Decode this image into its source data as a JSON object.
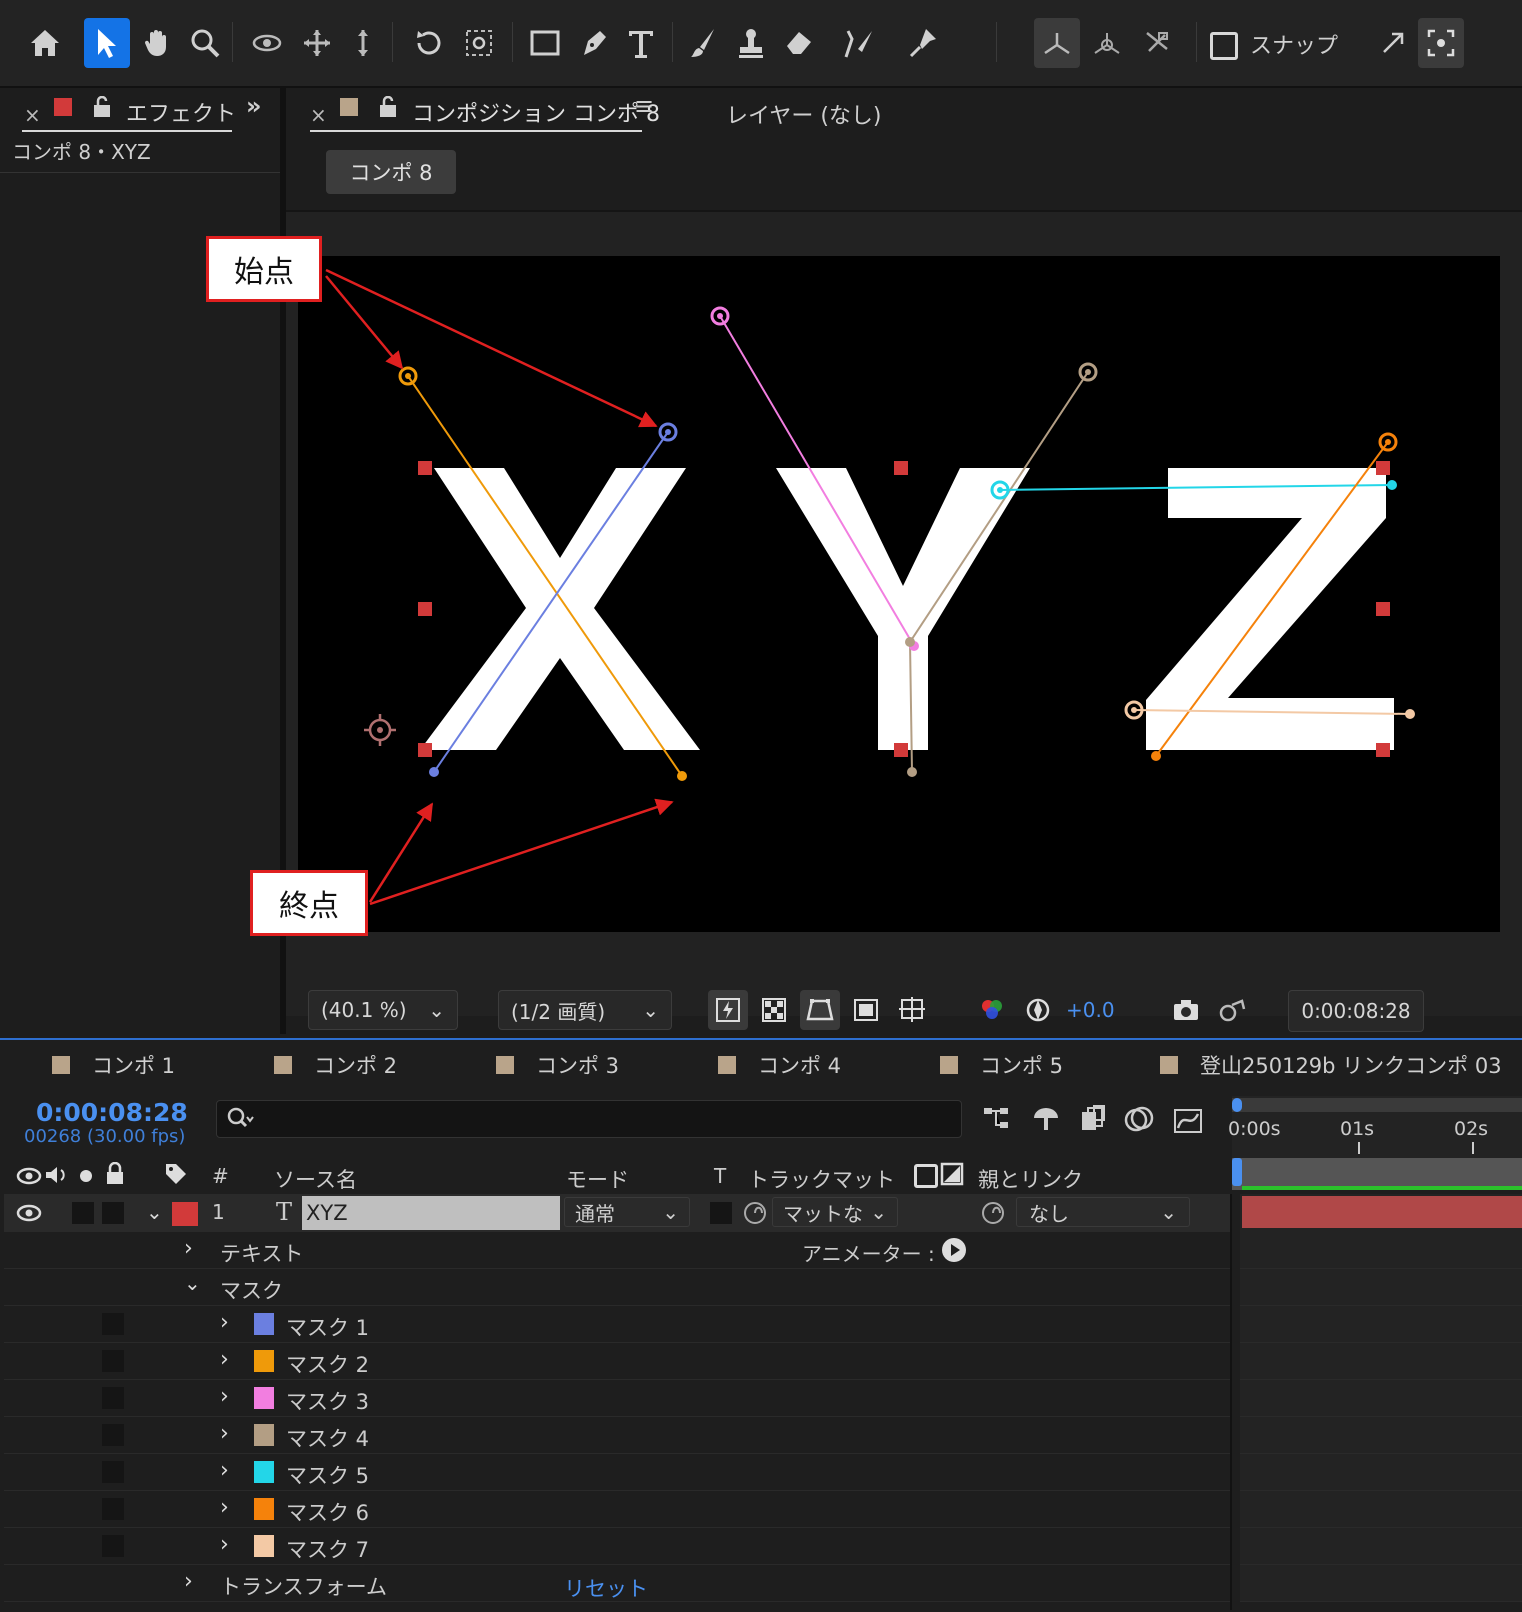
{
  "toolbar": {
    "snap_label": "スナップ",
    "icons": [
      "home-icon",
      "selection-tool-icon",
      "hand-tool-icon",
      "zoom-tool-icon",
      "orbit-camera-icon",
      "pan-camera-icon",
      "dolly-camera-icon",
      "rotation-tool-icon",
      "anchor-point-tool-icon",
      "rectangle-tool-icon",
      "pen-tool-icon",
      "type-tool-icon",
      "brush-tool-icon",
      "clone-stamp-icon",
      "eraser-tool-icon",
      "roto-brush-icon",
      "puppet-pin-icon",
      "local-axis-icon",
      "world-axis-icon",
      "view-axis-icon",
      "snap-checkbox",
      "expand-icon",
      "workspace-icon"
    ]
  },
  "effects_panel": {
    "tab_label": "エフェクトコ",
    "chip_color": "#d23a3a",
    "subtitle": "コンポ 8・XYZ"
  },
  "comp_panel": {
    "tab_label": "コンポジション コンポ 8",
    "chip_color": "#b9a48a",
    "layer_label": "レイヤー (なし)",
    "breadcrumb": "コンポ 8"
  },
  "canvas": {
    "letters": "XYZ",
    "callout_start": "始点",
    "callout_end": "終点"
  },
  "viewer_controls": {
    "zoom": "(40.1 %)",
    "resolution": "(1/2 画質)",
    "exposure": "+0.0",
    "timecode": "0:00:08:28"
  },
  "timeline": {
    "tabs": [
      "コンポ 1",
      "コンポ 2",
      "コンポ 3",
      "コンポ 4",
      "コンポ 5",
      "登山250129b リンクコンポ 03"
    ],
    "timecode": "0:00:08:28",
    "frames": "00268 (30.00 fps)",
    "ruler": [
      "0:00s",
      "01s",
      "02s"
    ],
    "headers": {
      "number": "#",
      "source_name": "ソース名",
      "mode": "モード",
      "t": "T",
      "track_matte": "トラックマット",
      "parent": "親とリンク"
    },
    "layer": {
      "index": "1",
      "name": "XYZ",
      "mode": "通常",
      "matte": "マットな",
      "parent": "なし",
      "label_color": "#d23a3a"
    },
    "text_group": "テキスト",
    "animator_label": "アニメーター :",
    "mask_group": "マスク",
    "masks": [
      {
        "name": "マスク 1",
        "color": "#6b7fe0"
      },
      {
        "name": "マスク 2",
        "color": "#ef9a0a"
      },
      {
        "name": "マスク 3",
        "color": "#f27ee0"
      },
      {
        "name": "マスク 4",
        "color": "#b39e84"
      },
      {
        "name": "マスク 5",
        "color": "#23d6e8"
      },
      {
        "name": "マスク 6",
        "color": "#f5820b"
      },
      {
        "name": "マスク 7",
        "color": "#f3c9a5"
      }
    ],
    "transform_group": "トランスフォーム",
    "reset_label": "リセット"
  }
}
